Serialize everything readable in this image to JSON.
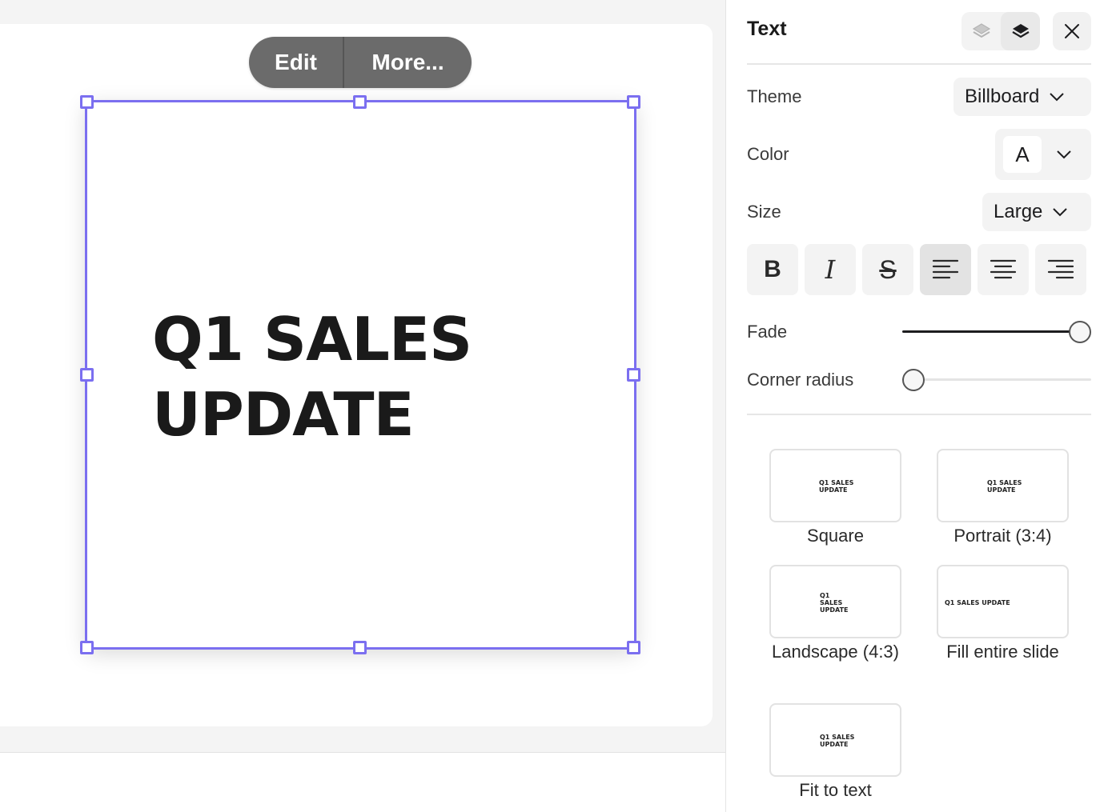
{
  "canvas": {
    "toolbar": {
      "edit_label": "Edit",
      "more_label": "More..."
    },
    "textbox": {
      "line1": "Q1 SALES",
      "line2": "UPDATE"
    }
  },
  "panel": {
    "title": "Text",
    "theme": {
      "label": "Theme",
      "value": "Billboard"
    },
    "color": {
      "label": "Color",
      "swatch": "A"
    },
    "size": {
      "label": "Size",
      "value": "Large"
    },
    "format": {
      "bold": "B",
      "italic": "I",
      "strike": "S",
      "selected_alignment": "left"
    },
    "fade": {
      "label": "Fade",
      "percent": 100
    },
    "corner_radius": {
      "label": "Corner radius",
      "percent": 0
    },
    "presets": [
      {
        "label": "Square",
        "line1": "Q1 SALES",
        "line2": "UPDATE"
      },
      {
        "label": "Portrait (3:4)",
        "line1": "Q1 SALES",
        "line2": "UPDATE"
      },
      {
        "label": "Landscape (4:3)",
        "line1": "Q1",
        "line2": "SALES",
        "line3": "UPDATE"
      },
      {
        "label": "Fill entire slide",
        "line1": "Q1 SALES UPDATE"
      },
      {
        "label": "Fit to text",
        "line1": "Q1 SALES",
        "line2": "UPDATE"
      }
    ]
  },
  "colors": {
    "selection": "#7b6ff0",
    "toolbar_bg": "#6b6b6b",
    "panel_bg": "#ffffff",
    "canvas_bg": "#f4f4f4"
  },
  "icons": {
    "layer_back": "layers-back-icon",
    "layer_front": "layers-front-icon",
    "close": "close-icon",
    "chevron": "chevron-down-icon",
    "align_left": "align-left-icon",
    "align_center": "align-center-icon",
    "align_right": "align-right-icon"
  }
}
